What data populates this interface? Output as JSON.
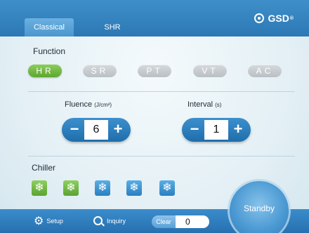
{
  "tabs": [
    {
      "label": "Classical",
      "active": true
    },
    {
      "label": "SHR",
      "active": false
    }
  ],
  "brand": {
    "name": "GSD",
    "mark": "®"
  },
  "function": {
    "label": "Function",
    "modes": [
      {
        "label": "HR",
        "active": true
      },
      {
        "label": "SR",
        "active": false
      },
      {
        "label": "PT",
        "active": false
      },
      {
        "label": "VT",
        "active": false
      },
      {
        "label": "AC",
        "active": false
      }
    ]
  },
  "fluence": {
    "label": "Fluence",
    "unit": "(J/cm²)",
    "value": "6",
    "minus": "−",
    "plus": "+"
  },
  "interval": {
    "label": "Interval",
    "unit": "(s)",
    "value": "1",
    "minus": "−",
    "plus": "+"
  },
  "chiller": {
    "label": "Chiller",
    "levels": [
      {
        "color": "green"
      },
      {
        "color": "green"
      },
      {
        "color": "blue"
      },
      {
        "color": "blue"
      },
      {
        "color": "blue"
      }
    ],
    "icon": "snowflake-icon"
  },
  "bottom": {
    "setup": "Setup",
    "inquiry": "Inquiry",
    "clear": "Clear",
    "count": "0",
    "standby": "Standby"
  },
  "colors": {
    "accent": "#2c78b5",
    "active_green": "#6cb63e",
    "inactive": "#c6cbcf"
  }
}
